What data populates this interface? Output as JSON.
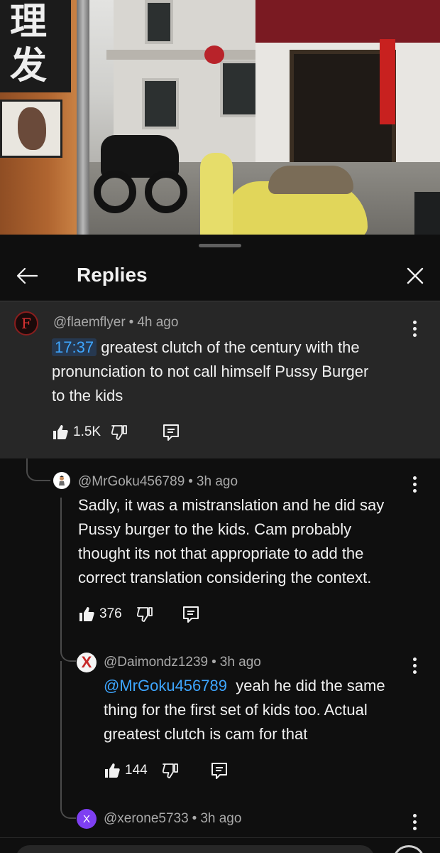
{
  "video": {
    "sign_chars": [
      "理",
      "发"
    ]
  },
  "header": {
    "title": "Replies"
  },
  "comments": [
    {
      "author": "@flaemflyer",
      "sep": "•",
      "time": "4h ago",
      "timestamp_link": "17:37",
      "lines": [
        "greatest clutch of the century with the",
        "pronunciation to not call himself Pussy Burger",
        "to the kids"
      ],
      "likes": "1.5K",
      "avatar_letter": "F",
      "avatar_color": "#8a1d1d"
    },
    {
      "author": "@MrGoku456789",
      "sep": "•",
      "time": "3h ago",
      "lines": [
        "Sadly, it was a mistranslation and he did say",
        "Pussy burger to the kids. Cam probably",
        "thought its not that appropriate to add the",
        "correct translation considering the context."
      ],
      "likes": "376"
    },
    {
      "author": "@Daimondz1239",
      "sep": "•",
      "time": "3h ago",
      "mention": "@MrGoku456789",
      "lines": [
        "yeah he did the same",
        "thing for the first set of kids too.  Actual",
        "greatest clutch is cam for that"
      ],
      "likes": "144",
      "avatar_letter": "X",
      "avatar_color": "#c62828"
    },
    {
      "author": "@xerone5733",
      "sep": "•",
      "time": "3h ago",
      "avatar_letter": "X",
      "avatar_color": "#7e3ff2"
    }
  ],
  "colors": {
    "background": "#0f0f0f",
    "highlight": "#272727",
    "link": "#3ea6ff",
    "secondary_text": "#aaaaaa"
  },
  "icons": [
    "back-arrow-icon",
    "close-icon",
    "more-vert-icon",
    "thumb-up-icon",
    "thumb-down-icon",
    "comment-icon",
    "emoji-icon"
  ]
}
